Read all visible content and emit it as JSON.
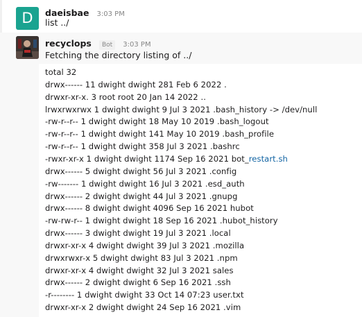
{
  "messages": [
    {
      "avatar_letter": "D",
      "username": "daeisbae",
      "time": "3:03 PM",
      "text": "list ../"
    },
    {
      "username": "recyclops",
      "bot_badge": "Bot",
      "time": "3:03 PM",
      "text": "Fetching the directory listing of ../"
    }
  ],
  "listing": [
    {
      "text": "total 32"
    },
    {
      "text": "drwx------ 11 dwight dwight 281 Feb 6 2022 ."
    },
    {
      "text": "drwxr-xr-x. 3 root root 20 Jan 14 2022 .."
    },
    {
      "text": "lrwxrwxrwx 1 dwight dwight 9 Jul 3 2021 .bash_history -> /dev/null"
    },
    {
      "text": "-rw-r--r-- 1 dwight dwight 18 May 10 2019 .bash_logout"
    },
    {
      "text": "-rw-r--r-- 1 dwight dwight 141 May 10 2019 .bash_profile"
    },
    {
      "text": "-rw-r--r-- 1 dwight dwight 358 Jul 3 2021 .bashrc"
    },
    {
      "text": "-rwxr-xr-x 1 dwight dwight 1174 Sep 16 2021 bot_",
      "link": "restart.sh"
    },
    {
      "text": "drwx------ 5 dwight dwight 56 Jul 3 2021 .config"
    },
    {
      "text": "-rw------- 1 dwight dwight 16 Jul 3 2021 .esd_auth"
    },
    {
      "text": "drwx------ 2 dwight dwight 44 Jul 3 2021 .gnupg"
    },
    {
      "text": "drwx------ 8 dwight dwight 4096 Sep 16 2021 hubot"
    },
    {
      "text": "-rw-rw-r-- 1 dwight dwight 18 Sep 16 2021 .hubot_history"
    },
    {
      "text": "drwx------ 3 dwight dwight 19 Jul 3 2021 .local"
    },
    {
      "text": "drwxr-xr-x 4 dwight dwight 39 Jul 3 2021 .mozilla"
    },
    {
      "text": "drwxrwxr-x 5 dwight dwight 83 Jul 3 2021 .npm"
    },
    {
      "text": "drwxr-xr-x 4 dwight dwight 32 Jul 3 2021 sales"
    },
    {
      "text": "drwx------ 2 dwight dwight 6 Sep 16 2021 .ssh"
    },
    {
      "text": "-r-------- 1 dwight dwight 33 Oct 14 07:23 user.txt"
    },
    {
      "text": "drwxr-xr-x 2 dwight dwight 24 Sep 16 2021 .vim"
    }
  ]
}
